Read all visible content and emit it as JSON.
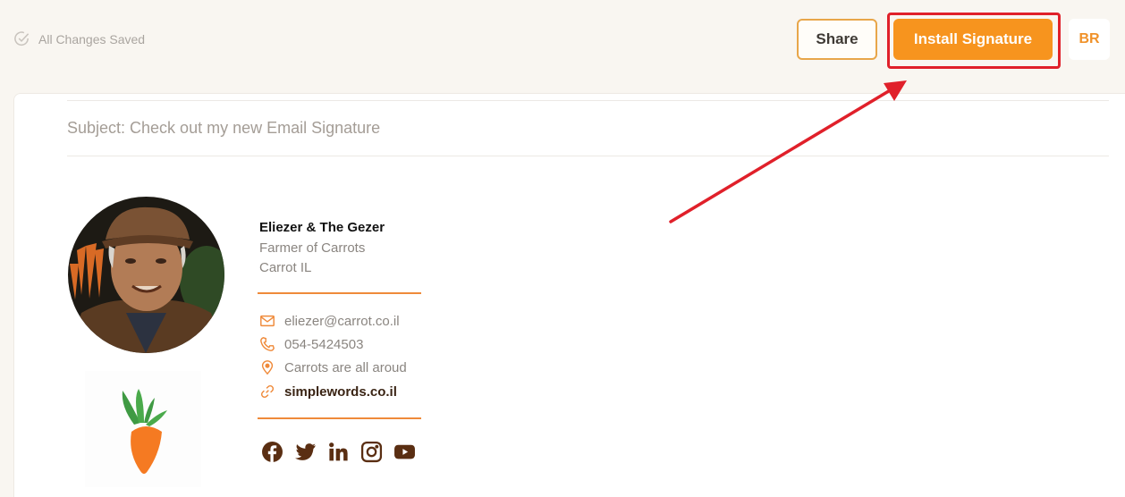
{
  "header": {
    "save_status": "All Changes Saved",
    "share_label": "Share",
    "install_label": "Install Signature",
    "user_initials": "BR"
  },
  "email": {
    "subject": "Subject: Check out my new Email Signature"
  },
  "signature": {
    "name": "Eliezer & The Gezer",
    "title": "Farmer of Carrots",
    "company": "Carrot IL",
    "contacts": [
      {
        "icon": "envelope-icon",
        "value": "eliezer@carrot.co.il"
      },
      {
        "icon": "phone-icon",
        "value": "054-5424503"
      },
      {
        "icon": "location-pin-icon",
        "value": "Carrots are all aroud"
      },
      {
        "icon": "link-icon",
        "value": "simplewords.co.il"
      }
    ],
    "social": [
      "facebook",
      "twitter",
      "linkedin",
      "instagram",
      "youtube"
    ],
    "accent_color": "#ef8a3a",
    "social_color": "#5a2e12"
  },
  "colors": {
    "primary_button": "#f7941e",
    "annotation_red": "#e0202a",
    "background": "#f9f6f1"
  }
}
